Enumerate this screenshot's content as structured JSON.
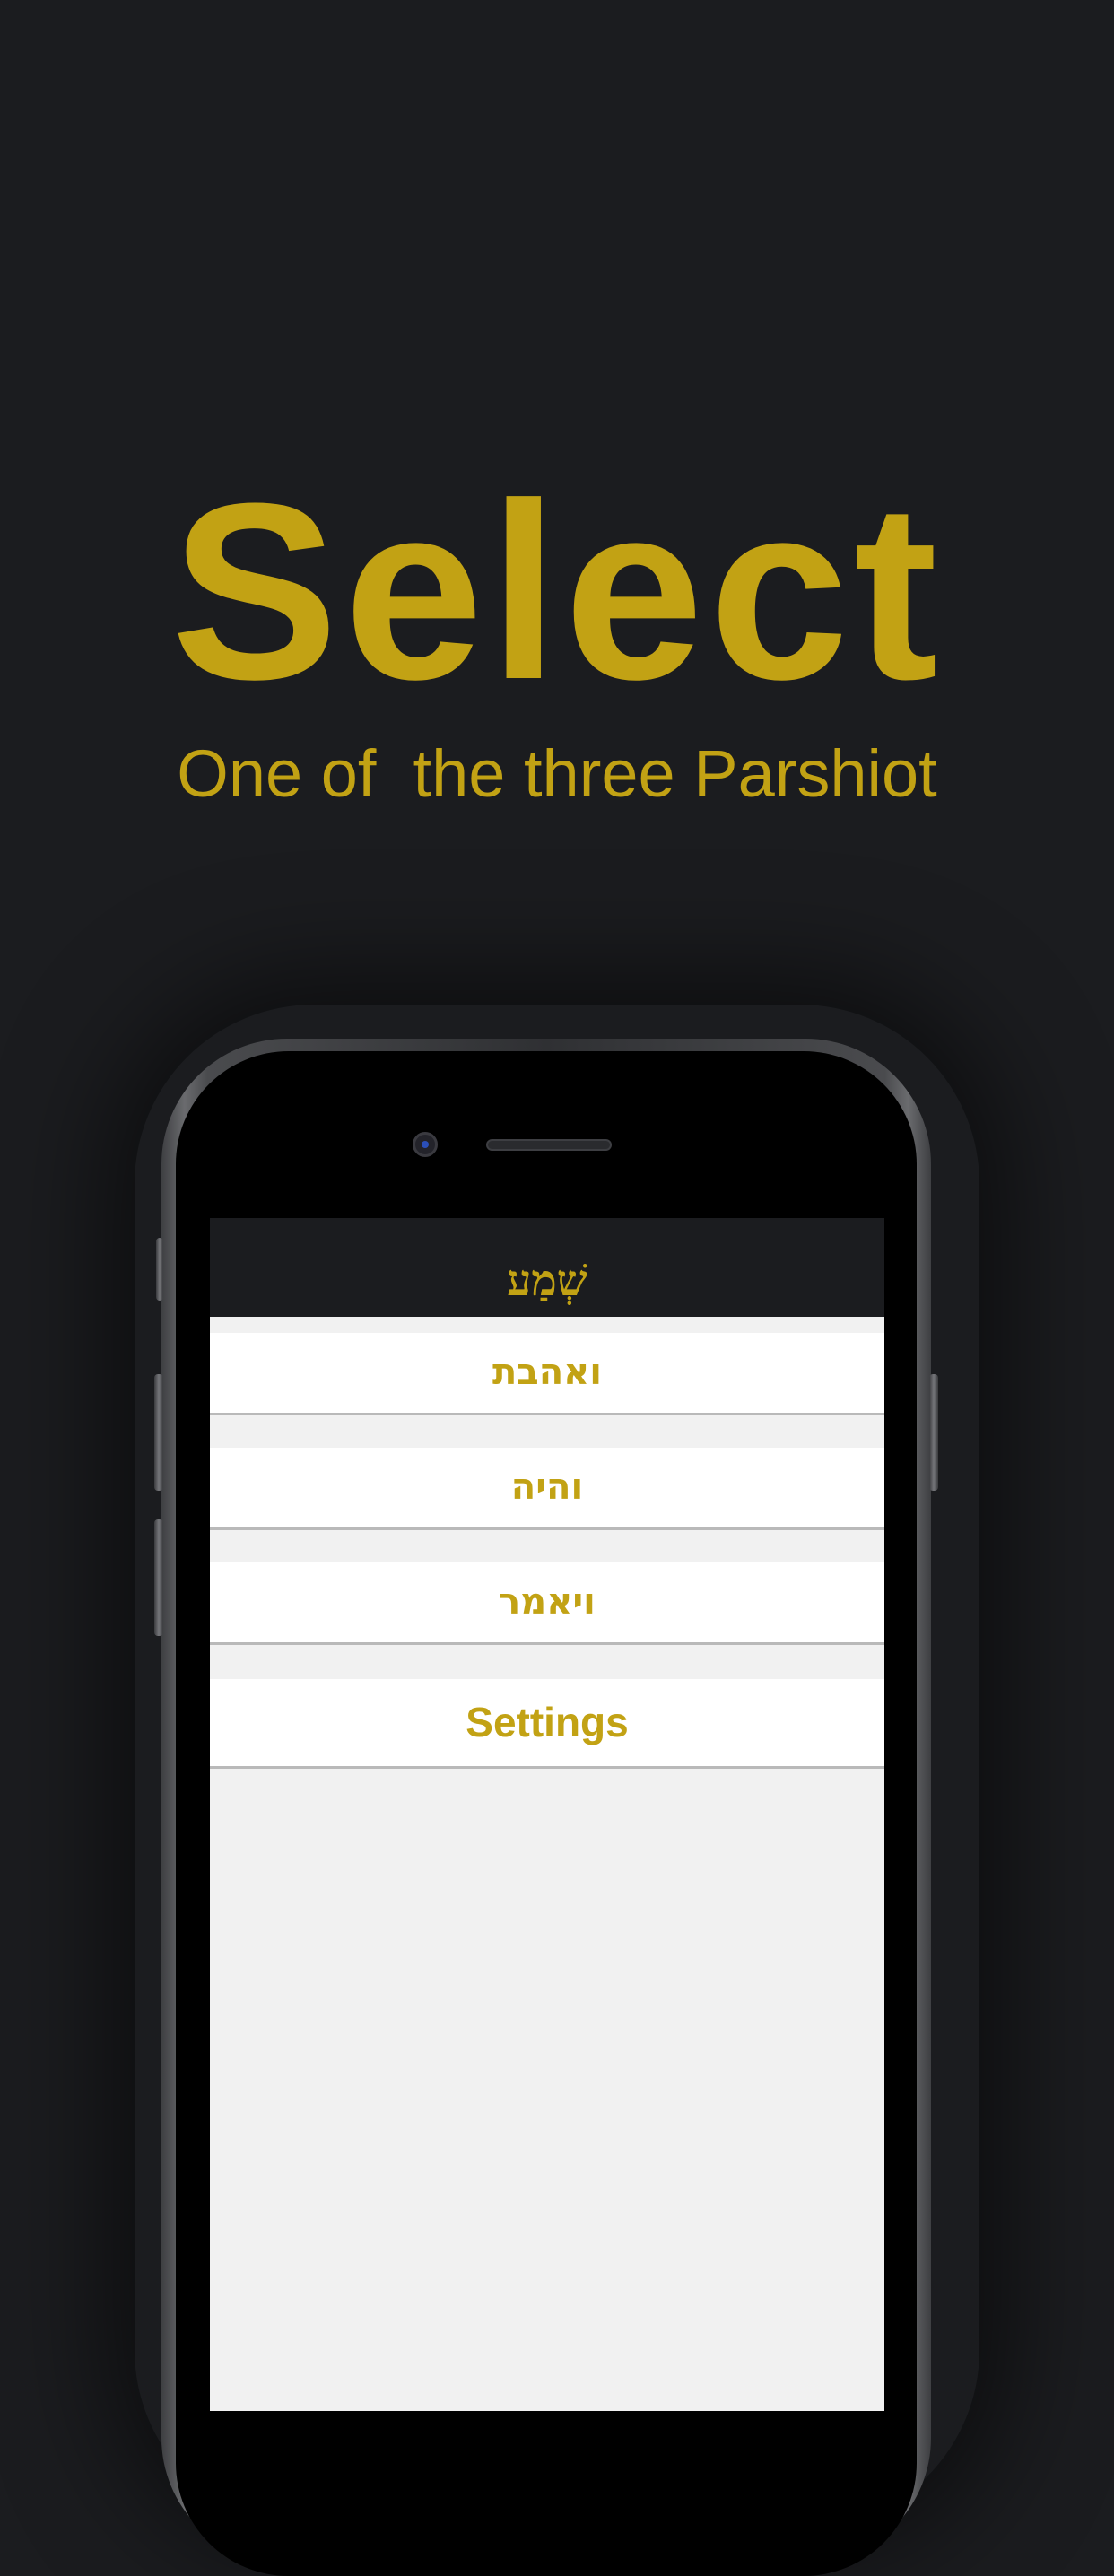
{
  "promo": {
    "headline": "Select",
    "subheadline": "One of  the three Parshiot"
  },
  "app": {
    "nav_title": "שְׁמַע",
    "menu_items": [
      {
        "label": "ואהבת"
      },
      {
        "label": "והיה"
      },
      {
        "label": "ויאמר"
      },
      {
        "label": "Settings"
      }
    ]
  },
  "colors": {
    "background": "#1b1c1f",
    "accent_gold": "#c2a214",
    "screen_background": "#f1f1f1",
    "row_background": "#ffffff"
  }
}
